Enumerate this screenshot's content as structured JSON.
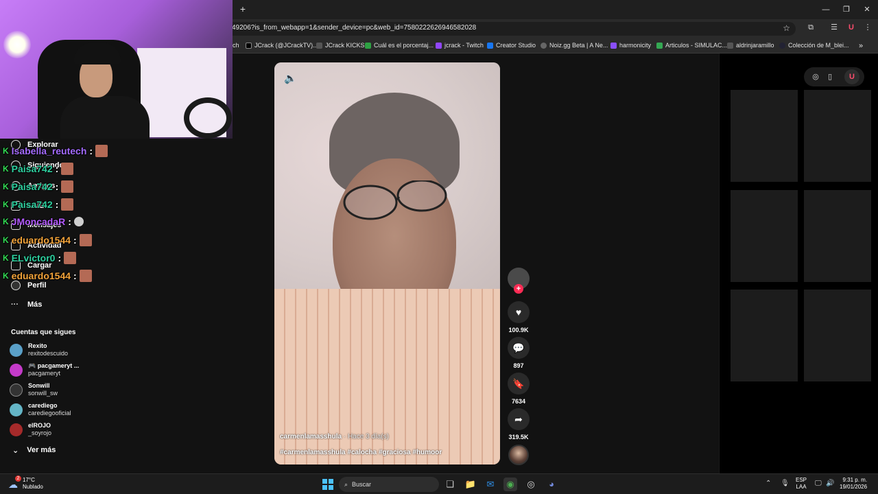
{
  "browser": {
    "url": "49206?is_from_webapp=1&sender_device=pc&web_id=7580222626946582028",
    "bookmarks": [
      {
        "label": "ch",
        "color": "#333"
      },
      {
        "label": "JCrack (@JCrackTV)...",
        "color": "#000"
      },
      {
        "label": "JCrack KICKS",
        "color": "#444"
      },
      {
        "label": "Cuál es el porcentaj...",
        "color": "#2ea043"
      },
      {
        "label": "jcrack - Twitch",
        "color": "#9146ff"
      },
      {
        "label": "Creator Studio",
        "color": "#1877f2"
      },
      {
        "label": "Noiz.gg Beta | A Ne...",
        "color": "#666"
      },
      {
        "label": "harmonicity",
        "color": "#8a4fff"
      },
      {
        "label": "Articulos - SIMULAC...",
        "color": "#34a853"
      },
      {
        "label": "aldrinjaramillo",
        "color": "#555"
      },
      {
        "label": "Colección de M_blei...",
        "color": "#223"
      }
    ]
  },
  "nav": {
    "items": [
      {
        "label": "Explorar"
      },
      {
        "label": "Siguiendo"
      },
      {
        "label": "Amigos"
      },
      {
        "label": "LIVE"
      },
      {
        "label": "Mensajes"
      },
      {
        "label": "Actividad"
      },
      {
        "label": "Cargar"
      },
      {
        "label": "Perfil"
      },
      {
        "label": "Más"
      }
    ],
    "following_title": "Cuentas que sigues",
    "following": [
      {
        "name": "Rexito",
        "handle": "rexitodescuido",
        "color": "#5aa0c8"
      },
      {
        "name": "🎮 pacgameryt ...",
        "handle": "pacgameryt",
        "color": "#c43ac9"
      },
      {
        "name": "Sonwill",
        "handle": "sonwill_sw",
        "color": "#333"
      },
      {
        "name": "carediego",
        "handle": "carediegooficial",
        "color": "#64b5c6"
      },
      {
        "name": "elROJO",
        "handle": "_soyrojo",
        "color": "#a52a2a"
      }
    ],
    "see_more": "Ver más"
  },
  "chat": [
    {
      "user": "Isabella_reutech",
      "color": "#a46bff"
    },
    {
      "user": "Paisa742",
      "color": "#2ed1a0"
    },
    {
      "user": "Paisa742",
      "color": "#2ed1a0"
    },
    {
      "user": "Paisa742",
      "color": "#2ed1a0"
    },
    {
      "user": "JMoncadaR",
      "color": "#b45bff"
    },
    {
      "user": "eduardo1544",
      "color": "#f2a33a"
    },
    {
      "user": "ELvictor0",
      "color": "#2ed1a0"
    },
    {
      "user": "eduardo1544",
      "color": "#f2a33a"
    }
  ],
  "video": {
    "author": "carmenlamasshula",
    "time": " · Hace 3 día(s)",
    "tags": "#carmenlamasshula #calocha #graciosa #humoor",
    "likes": "100.9K",
    "comments": "897",
    "saves": "7634",
    "shares": "319.5K"
  },
  "taskbar": {
    "temp": "17°C",
    "weather": "Nublado",
    "search": "Buscar",
    "lang1": "ESP",
    "lang2": "LAA",
    "time": "9:31 p. m.",
    "date": "19/01/2026",
    "weather_badge": "2"
  }
}
